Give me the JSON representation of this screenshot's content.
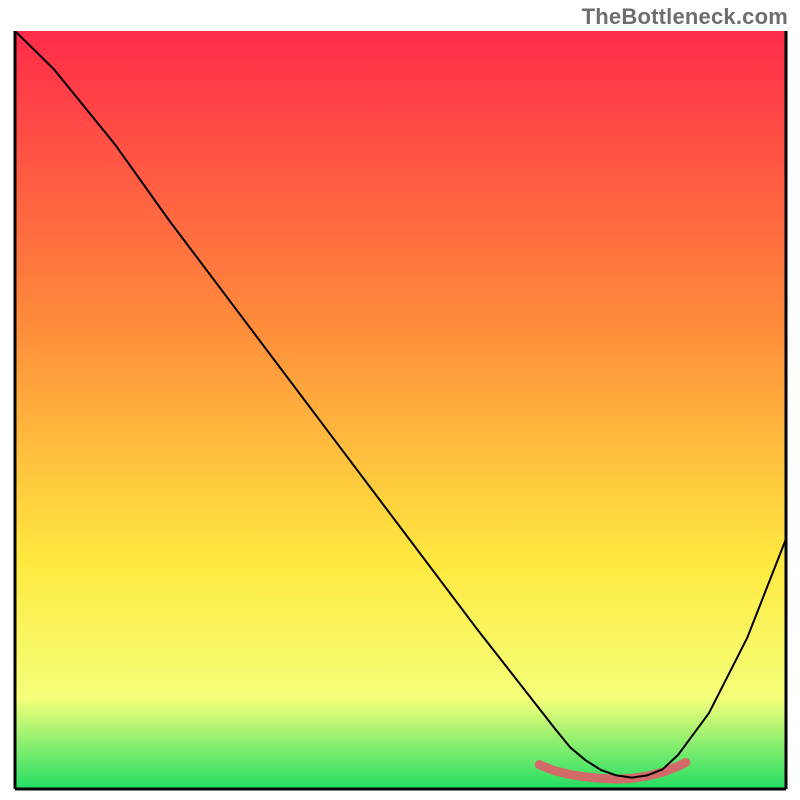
{
  "watermark": "TheBottleneck.com",
  "chart_data": {
    "type": "line",
    "title": "",
    "xlabel": "",
    "ylabel": "",
    "xlim": [
      0,
      100
    ],
    "ylim": [
      0,
      100
    ],
    "grid": false,
    "legend": false,
    "background_gradient": {
      "top_color": "#ff2b4a",
      "mid_color_1": "#ff8a3b",
      "mid_color_2": "#ffe940",
      "bottom_color": "#22de64",
      "direction": "vertical"
    },
    "series": [
      {
        "name": "bottleneck-curve",
        "color": "#000000",
        "stroke_width": 2,
        "x": [
          0,
          5,
          9,
          13,
          20,
          30,
          40,
          50,
          60,
          65,
          70,
          72,
          74,
          76,
          78,
          80,
          82,
          84,
          86,
          90,
          95,
          100
        ],
        "y": [
          100,
          95,
          90,
          85,
          75,
          61.5,
          48,
          34.5,
          21,
          14.5,
          8,
          5.5,
          3.8,
          2.5,
          1.8,
          1.5,
          1.8,
          2.6,
          4.5,
          10,
          20,
          33
        ]
      },
      {
        "name": "optimal-zone-marker",
        "color": "#d36a6a",
        "stroke_width": 9,
        "linecap": "round",
        "x": [
          68,
          70,
          72,
          74,
          76,
          78,
          80,
          82,
          84,
          86,
          87
        ],
        "y": [
          3.2,
          2.4,
          1.9,
          1.6,
          1.4,
          1.3,
          1.4,
          1.7,
          2.2,
          3.0,
          3.5
        ]
      }
    ],
    "frame": {
      "visible_sides": [
        "left",
        "right",
        "bottom"
      ],
      "color": "#000000",
      "width": 2
    }
  }
}
